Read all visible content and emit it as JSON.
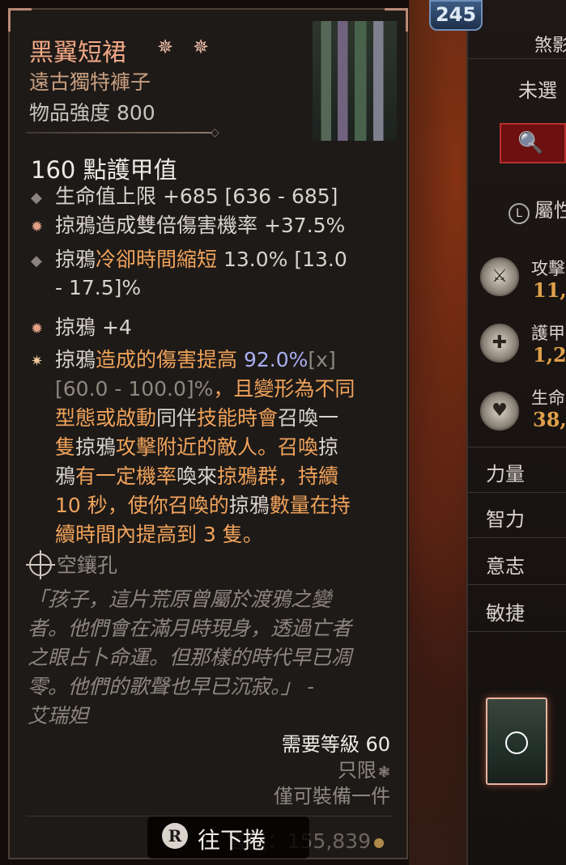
{
  "item": {
    "name": "黑翼短裙",
    "type": "遠古獨特褲子",
    "power": "物品強度 800",
    "armor": "160 點護甲值",
    "affixes": [
      {
        "text": "生命值上限 +685 [636 - 685]"
      },
      {
        "text": "掠鴉造成雙倍傷害機率 +37.5%"
      },
      {
        "line1": "掠鴉",
        "line1b": "冷卻時間縮短",
        "line1c": " 13.0% [13.0",
        "line2": "- 17.5]%"
      },
      {
        "text": "掠鴉 +4"
      }
    ],
    "unique_power": {
      "l1a": "掠鴉",
      "l1b": "造成的傷害提高 ",
      "l1c": "92.0%",
      "l1d": "[x]",
      "l2a": "[60.0 - 100.0]%",
      "l2b": "，且變形為不同",
      "l3a": "型態或啟動",
      "l3b": "同伴",
      "l3c": "技能時會",
      "l3d": "召喚一",
      "l4a": "隻",
      "l4b": "掠鴉",
      "l4c": "攻擊附近的敵人。召喚",
      "l4d": "掠",
      "l5a": "鴉",
      "l5b": "有一定機率",
      "l5c": "喚來",
      "l5d": "掠鴉群，持續",
      "l6": "10 秒，使你召喚的",
      "l6b": "掠鴉",
      "l6c": "數量在持",
      "l7": "續時間內提高到 3 隻。"
    },
    "socket": "空鑲孔",
    "flavor": [
      "「孩子，這片荒原曾屬於渡鴉之變",
      "者。他們會在滿月時現身，透過亡者",
      "之眼占卜命運。但那樣的時代早已凋",
      "零。他們的歌聲也早已沉寂。」 -",
      "艾瑞妲"
    ],
    "required_level": "需要等級 60",
    "class_only": "只限",
    "equip_limit": "僅可裝備一件",
    "sell_value_label": "售價：155,839"
  },
  "scroll_hint": {
    "key": "R",
    "label": "往下捲"
  },
  "character": {
    "level": "245",
    "header_1": "煞影",
    "header_2": "未選",
    "attributes_label": "屬性",
    "stats": [
      {
        "label": "攻擊",
        "value": "11,"
      },
      {
        "label": "護甲",
        "value": "1,2"
      },
      {
        "label": "生命",
        "value": "38,"
      }
    ],
    "core": [
      "力量",
      "智力",
      "意志",
      "敏捷"
    ]
  }
}
